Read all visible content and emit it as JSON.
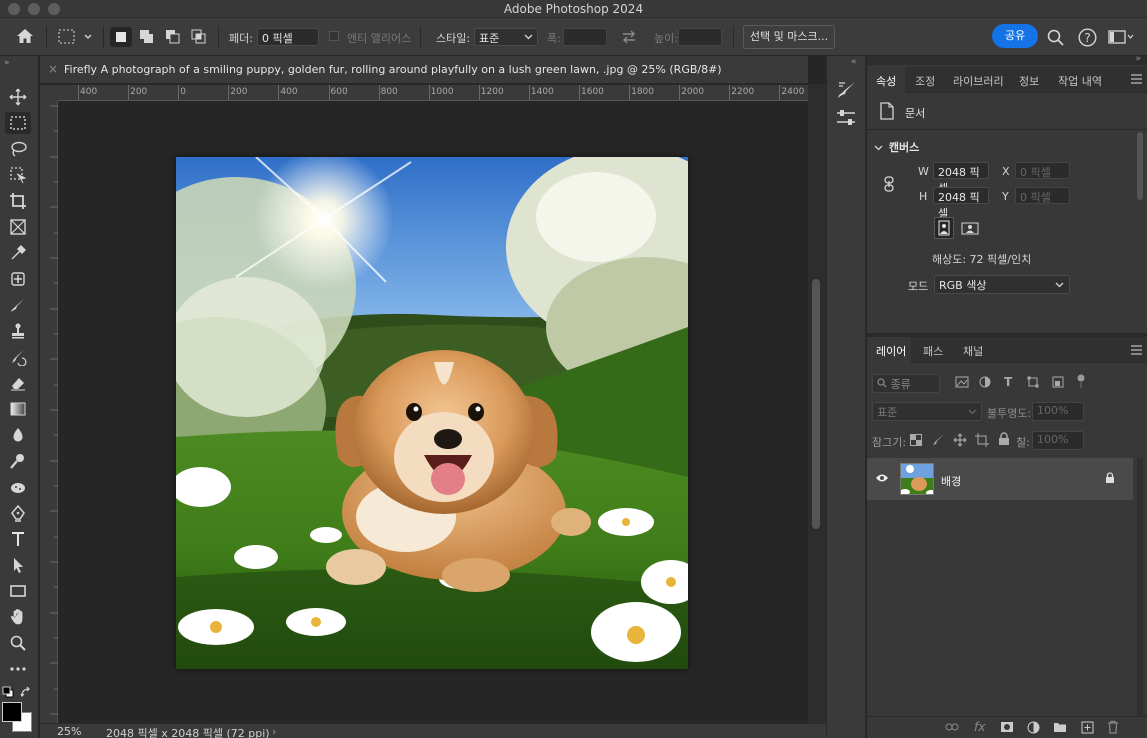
{
  "app_title": "Adobe Photoshop 2024",
  "options": {
    "feather_label": "페더:",
    "feather_value": "0 픽셀",
    "antialias_label": "앤티 앨리어스",
    "style_label": "스타일:",
    "style_value": "표준",
    "width_label": "폭:",
    "height_label": "높이:",
    "select_mask_label": "선택 및 마스크...",
    "share_label": "공유"
  },
  "document": {
    "tab_title": "Firefly A photograph of a smiling puppy, golden fur, rolling around playfully on a lush green lawn, .jpg @ 25% (RGB/8#)",
    "zoom": "25%",
    "size_info": "2048 픽셀 x 2048 픽셀 (72 ppi)"
  },
  "ruler": {
    "h_ticks": [
      "400",
      "200",
      "0",
      "200",
      "400",
      "600",
      "800",
      "1000",
      "1200",
      "1400",
      "1600",
      "1800",
      "2000",
      "2200",
      "2400"
    ]
  },
  "properties_panel": {
    "tabs": [
      "속성",
      "조정",
      "라이브러리",
      "정보",
      "작업 내역"
    ],
    "active_tab": "속성",
    "doc_label": "문서",
    "canvas_section": "캔버스",
    "w_label": "W",
    "w_value": "2048 픽셀",
    "h_label": "H",
    "h_value": "2048 픽셀",
    "x_label": "X",
    "x_placeholder": "0 픽셀",
    "y_label": "Y",
    "y_placeholder": "0 픽셀",
    "resolution": "해상도: 72 픽셀/인치",
    "mode_label": "모드",
    "mode_value": "RGB 색상"
  },
  "layers_panel": {
    "tabs": [
      "레이어",
      "패스",
      "채널"
    ],
    "active_tab": "레이어",
    "filter_label": "종류",
    "blend_mode": "표준",
    "opacity_label": "불투명도:",
    "opacity_value": "100%",
    "lock_label": "잠그기:",
    "fill_label": "칠:",
    "fill_value": "100%",
    "layers": [
      {
        "name": "배경",
        "visible": true,
        "locked": true
      }
    ]
  },
  "colors": {
    "accent": "#1473e6",
    "foreground": "#000000",
    "background": "#ffffff"
  }
}
